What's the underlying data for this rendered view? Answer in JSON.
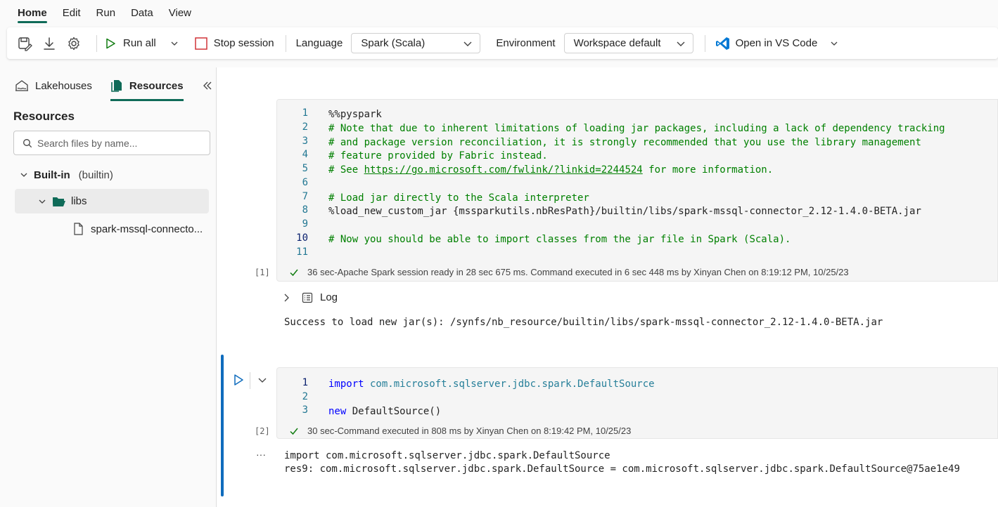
{
  "menu": [
    "Home",
    "Edit",
    "Run",
    "Data",
    "View"
  ],
  "toolbar": {
    "run_all": "Run all",
    "stop_session": "Stop session",
    "language_label": "Language",
    "language_value": "Spark (Scala)",
    "environment_label": "Environment",
    "environment_value": "Workspace default",
    "open_vscode": "Open in VS Code"
  },
  "sidebar": {
    "tab_lakehouses": "Lakehouses",
    "tab_resources": "Resources",
    "title": "Resources",
    "search_placeholder": "Search files by name...",
    "builtin_label": "Built-in",
    "builtin_sub": "(builtin)",
    "libs_label": "libs",
    "file_label": "spark-mssql-connecto..."
  },
  "cell1": {
    "exec_count": "[1]",
    "line_numbers": [
      "1",
      "2",
      "3",
      "4",
      "5",
      "6",
      "7",
      "8",
      "9",
      "10",
      "11"
    ],
    "lines": {
      "l1": "%%pyspark",
      "l2": "# Note that due to inherent limitations of loading jar packages, including a lack of dependency tracking",
      "l3": "# and package version reconciliation, it is strongly recommended that you use the library management",
      "l4": "# feature provided by Fabric instead.",
      "l5a": "# See ",
      "l5link": "https://go.microsoft.com/fwlink/?linkid=2244524",
      "l5b": " for more information.",
      "l7": "# Load jar directly to the Scala interpreter",
      "l8": "%load_new_custom_jar {mssparkutils.nbResPath}/builtin/libs/spark-mssql-connector_2.12-1.4.0-BETA.jar",
      "l10": "# Now you should be able to import classes from the jar file in Spark (Scala)."
    },
    "duration": "36 sec",
    "status": " -Apache Spark session ready in 28 sec 675 ms. Command executed in 6 sec 448 ms by Xinyan Chen on 8:19:12 PM, 10/25/23",
    "log_label": "Log",
    "output": "Success to load new jar(s): /synfs/nb_resource/builtin/libs/spark-mssql-connector_2.12-1.4.0-BETA.jar"
  },
  "cell2": {
    "exec_count": "[2]",
    "line_numbers": [
      "1",
      "2",
      "3"
    ],
    "lines": {
      "l1_kw": "import",
      "l1_pkg": " com.microsoft.sqlserver.jdbc.spark.",
      "l1_cls": "DefaultSource",
      "l3_kw": "new",
      "l3_rest": " DefaultSource()"
    },
    "duration": "30 sec",
    "status": " -Command executed in 808 ms by Xinyan Chen on 8:19:42 PM, 10/25/23",
    "output_marker": "···",
    "output1": "import com.microsoft.sqlserver.jdbc.spark.DefaultSource",
    "output2": "res9: com.microsoft.sqlserver.jdbc.spark.DefaultSource = com.microsoft.sqlserver.jdbc.spark.DefaultSource@75ae1e49"
  },
  "colors": {
    "accent": "#0f6b58",
    "comment": "#008000",
    "keyword": "#0000ff",
    "line_number": "#237893",
    "active_bar": "#0f6cbd"
  }
}
